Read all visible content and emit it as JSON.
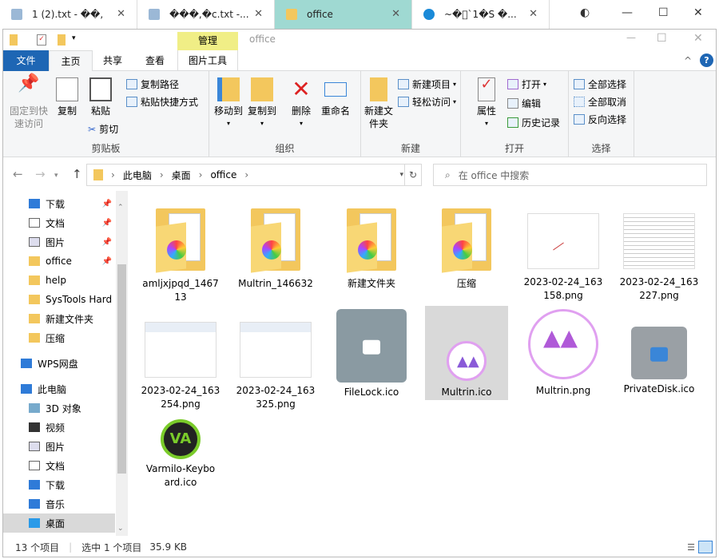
{
  "browser_tabs": [
    {
      "title": "1 (2).txt - ��,",
      "icon": "notepad-icon"
    },
    {
      "title": "���,�c.txt -...",
      "icon": "notepad-icon"
    },
    {
      "title": "office",
      "icon": "folder-icon",
      "active": true
    },
    {
      "title": "~�\u0000`1�S �...",
      "icon": "edge-icon"
    }
  ],
  "window": {
    "title": "office",
    "context_tab": "管理",
    "context_color": "#f0ee86"
  },
  "ribbon_tabs": [
    "文件",
    "主页",
    "共享",
    "查看",
    "图片工具"
  ],
  "ribbon": {
    "clipboard": {
      "label": "剪贴板",
      "pin": "固定到快速访问",
      "copy": "复制",
      "paste": "粘贴",
      "copy_path": "复制路径",
      "paste_shortcut": "粘贴快捷方式",
      "cut": "剪切"
    },
    "organize": {
      "label": "组织",
      "move_to": "移动到",
      "copy_to": "复制到",
      "delete": "删除",
      "rename": "重命名"
    },
    "new": {
      "label": "新建",
      "new_folder": "新建文件夹",
      "new_item": "新建项目",
      "easy_access": "轻松访问"
    },
    "open": {
      "label": "打开",
      "properties": "属性",
      "open": "打开",
      "edit": "编辑",
      "history": "历史记录"
    },
    "select": {
      "label": "选择",
      "select_all": "全部选择",
      "select_none": "全部取消",
      "invert": "反向选择"
    }
  },
  "address": {
    "crumbs": [
      "此电脑",
      "桌面",
      "office"
    ],
    "search_placeholder": "在 office 中搜索"
  },
  "sidebar": {
    "quick": [
      {
        "label": "下载",
        "icon": "download-icon",
        "pinned": true
      },
      {
        "label": "文档",
        "icon": "document-icon",
        "pinned": true
      },
      {
        "label": "图片",
        "icon": "pictures-icon",
        "pinned": true
      },
      {
        "label": "office",
        "icon": "folder-icon",
        "pinned": true
      },
      {
        "label": "help",
        "icon": "folder-icon"
      },
      {
        "label": "SysTools Hard",
        "icon": "folder-icon"
      },
      {
        "label": "新建文件夹",
        "icon": "folder-icon"
      },
      {
        "label": "压缩",
        "icon": "folder-icon"
      }
    ],
    "wps": "WPS网盘",
    "pc": "此电脑",
    "pc_items": [
      {
        "label": "3D 对象",
        "icon": "3d-icon"
      },
      {
        "label": "视频",
        "icon": "video-icon"
      },
      {
        "label": "图片",
        "icon": "pictures-icon"
      },
      {
        "label": "文档",
        "icon": "document-icon"
      },
      {
        "label": "下载",
        "icon": "download-icon"
      },
      {
        "label": "音乐",
        "icon": "music-icon"
      },
      {
        "label": "桌面",
        "icon": "desktop-icon",
        "selected": true
      }
    ]
  },
  "files": [
    {
      "name": "amljxjpqd_1467\n13",
      "type": "folder"
    },
    {
      "name": "Multrin_146632",
      "type": "folder"
    },
    {
      "name": "新建文件夹",
      "type": "folder"
    },
    {
      "name": "压缩",
      "type": "folder"
    },
    {
      "name": "2023-02-24_163\n158.png",
      "type": "png-blank"
    },
    {
      "name": "2023-02-24_163\n227.png",
      "type": "png-doc"
    },
    {
      "name": "2023-02-24_163\n254.png",
      "type": "png-shot"
    },
    {
      "name": "2023-02-24_163\n325.png",
      "type": "png-shot"
    },
    {
      "name": "FileLock.ico",
      "type": "lock-folder"
    },
    {
      "name": "Multrin.ico",
      "type": "multrin-small",
      "selected": true
    },
    {
      "name": "Multrin.png",
      "type": "multrin-big"
    },
    {
      "name": "PrivateDisk.ico",
      "type": "private-disk"
    },
    {
      "name": "Varmilo-Keybo\nard.ico",
      "type": "varmilo"
    }
  ],
  "status": {
    "count": "13 个项目",
    "selected": "选中 1 个项目",
    "size": "35.9 KB"
  }
}
